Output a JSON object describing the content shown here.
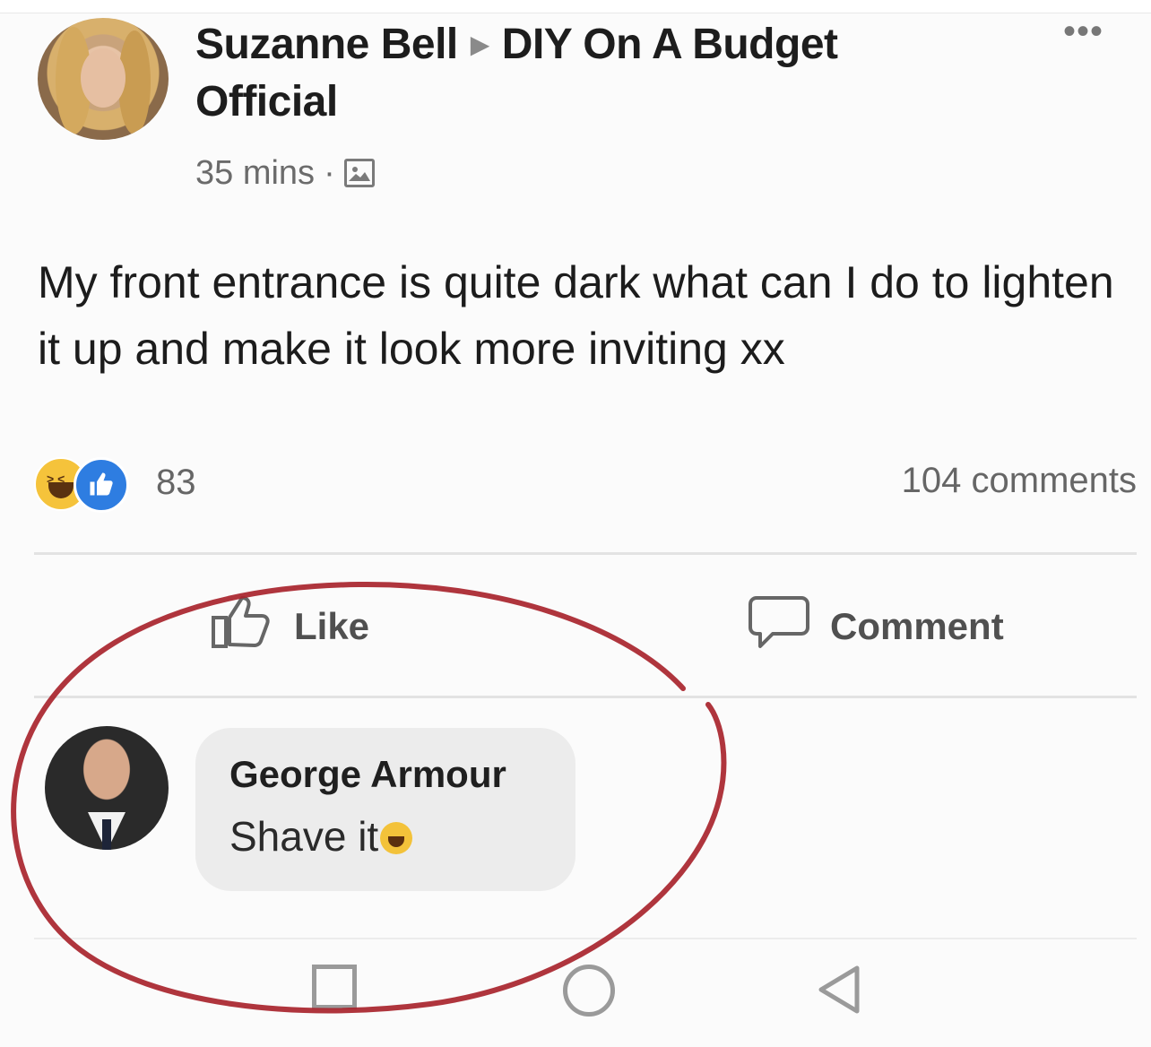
{
  "post": {
    "author": "Suzanne Bell",
    "group": "DIY On A Budget",
    "group_line2": "Official",
    "time": "35 mins",
    "privacy_icon": "photo-icon",
    "text": "My front entrance is quite dark what can I do to lighten it up and make it look more inviting xx",
    "more_icon": "more-dots-icon"
  },
  "reactions": {
    "count": "83",
    "icons": [
      "haha-reaction-icon",
      "like-reaction-icon"
    ],
    "comments_label": "104 comments"
  },
  "actions": {
    "like_label": "Like",
    "comment_label": "Comment"
  },
  "comment": {
    "author": "George Armour",
    "text": "Shave it",
    "emoji": "laughing-emoji-icon"
  },
  "colors": {
    "annotation_circle": "#a8242c",
    "like_blue": "#2e7de1",
    "haha_yellow": "#f5c33b",
    "bubble_bg": "#ececec"
  },
  "nav_icons": [
    "recent-apps-icon",
    "home-icon",
    "back-icon"
  ]
}
